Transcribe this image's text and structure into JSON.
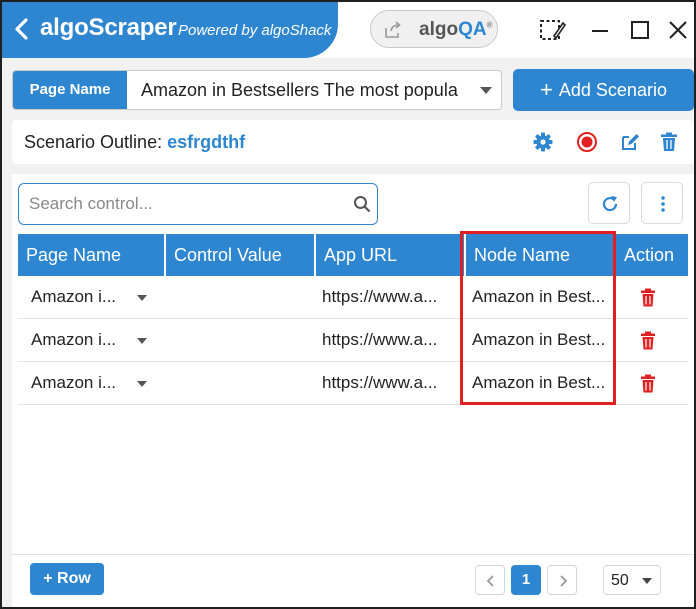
{
  "titlebar": {
    "app_title": "algoScraper",
    "powered_by": "Powered by algoShack",
    "algoqa_prefix": "algo",
    "algoqa_suffix": "QA",
    "algoqa_mark": "®"
  },
  "page_selector": {
    "label": "Page Name",
    "value": "Amazon in Bestsellers The most popula"
  },
  "add_scenario_label": "Add Scenario",
  "scenario": {
    "label": "Scenario Outline:",
    "name": "esfrgdthf"
  },
  "search": {
    "placeholder": "Search control..."
  },
  "table": {
    "headers": [
      "Page Name",
      "Control Value",
      "App URL",
      "Node Name",
      "Action"
    ],
    "rows": [
      {
        "page_name": "Amazon i...",
        "control_value": "",
        "app_url": "https://www.a...",
        "node_name": "Amazon in Best..."
      },
      {
        "page_name": "Amazon i...",
        "control_value": "",
        "app_url": "https://www.a...",
        "node_name": "Amazon in Best..."
      },
      {
        "page_name": "Amazon i...",
        "control_value": "",
        "app_url": "https://www.a...",
        "node_name": "Amazon in Best..."
      }
    ]
  },
  "footer": {
    "add_row_label": "+ Row",
    "current_page": "1",
    "per_page": "50"
  },
  "colors": {
    "accent": "#2e86d1",
    "record": "#e02020",
    "delete": "#e02020",
    "highlight": "#e02020"
  },
  "icons": [
    "back-icon",
    "share-icon",
    "screenshot-icon",
    "minimize-icon",
    "maximize-icon",
    "close-icon",
    "chevron-down-icon",
    "plus-icon",
    "gear-icon",
    "record-icon",
    "edit-icon",
    "trash-icon",
    "search-icon",
    "refresh-icon",
    "more-vertical-icon",
    "chevron-left-icon",
    "chevron-right-icon"
  ]
}
